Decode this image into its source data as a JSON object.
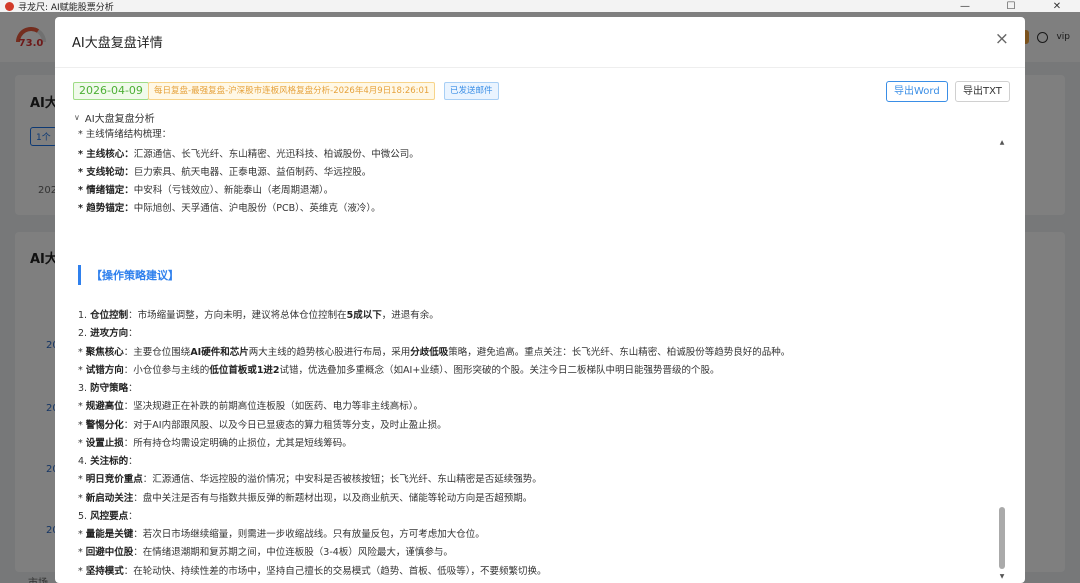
{
  "window": {
    "title": "寻龙尺: AI赋能股票分析",
    "minimize": "—",
    "maximize": "☐",
    "close": "✕"
  },
  "app": {
    "gauge_value": "73.0",
    "vip_label": "vip",
    "bg_title_1": "AI大",
    "bg_btn_1": "1个",
    "bg_date_prefix": "202",
    "bg_title_2": "AI大",
    "bg_row_labels": [
      "20",
      "20",
      "20",
      "20",
      "20"
    ],
    "bg_bottom": "市场"
  },
  "modal": {
    "title": "AI大盘复盘详情",
    "close_icon": "×",
    "date_tag": "2026-04-09",
    "report_tag": "每日复盘-最强复盘-沪深股市连板风格复盘分析-2026年4月9日18:26:01",
    "mail_tag": "已发送邮件",
    "export_word": "导出Word",
    "export_txt": "导出TXT",
    "section_title": "AI大盘复盘分析",
    "cut_line": "* 主线情绪结构梳理：",
    "top_lines": [
      {
        "bold": "* 主线核心：",
        "text": "汇源通信、长飞光纤、东山精密、光迅科技、柏诚股份、中微公司。"
      },
      {
        "bold": "* 支线轮动：",
        "text": "巨力索具、航天电器、正泰电源、益佰制药、华远控股。"
      },
      {
        "bold": "* 情绪锚定：",
        "text": "中安科（亏钱效应）、新能泰山（老周期退潮）。"
      },
      {
        "bold": "* 趋势锚定：",
        "text": "中际旭创、天孚通信、沪电股份（PCB）、英维克（液冷）。"
      }
    ],
    "strategy_title": "【操作策略建议】",
    "strategy_lines": [
      {
        "segments": [
          {
            "t": "1. "
          },
          {
            "t": "仓位控制",
            "b": true
          },
          {
            "t": "：市场缩量调整，方向未明，建议将总体仓位控制在"
          },
          {
            "t": "5成以下",
            "b": true
          },
          {
            "t": "，进退有余。"
          }
        ]
      },
      {
        "segments": [
          {
            "t": "2. "
          },
          {
            "t": "进攻方向",
            "b": true
          },
          {
            "t": "："
          }
        ]
      },
      {
        "segments": [
          {
            "t": "* "
          },
          {
            "t": "聚焦核心",
            "b": true
          },
          {
            "t": "：主要仓位围绕"
          },
          {
            "t": "AI硬件和芯片",
            "b": true
          },
          {
            "t": "两大主线的趋势核心股进行布局，采用"
          },
          {
            "t": "分歧低吸",
            "b": true
          },
          {
            "t": "策略，避免追高。重点关注：长飞光纤、东山精密、柏诚股份等趋势良好的品种。"
          }
        ]
      },
      {
        "segments": [
          {
            "t": "* "
          },
          {
            "t": "试错方向",
            "b": true
          },
          {
            "t": "：小仓位参与主线的"
          },
          {
            "t": "低位首板或1进2",
            "b": true
          },
          {
            "t": "试错，优选叠加多重概念（如AI+业绩）、图形突破的个股。关注今日二板梯队中明日能强势晋级的个股。"
          }
        ]
      },
      {
        "segments": [
          {
            "t": "3. "
          },
          {
            "t": "防守策略",
            "b": true
          },
          {
            "t": "："
          }
        ]
      },
      {
        "segments": [
          {
            "t": "* "
          },
          {
            "t": "规避高位",
            "b": true
          },
          {
            "t": "：坚决规避正在补跌的前期高位连板股（如医药、电力等非主线高标）。"
          }
        ]
      },
      {
        "segments": [
          {
            "t": "* "
          },
          {
            "t": "警惕分化",
            "b": true
          },
          {
            "t": "：对于AI内部跟风股、以及今日已显疲态的算力租赁等分支，及时止盈止损。"
          }
        ]
      },
      {
        "segments": [
          {
            "t": "* "
          },
          {
            "t": "设置止损",
            "b": true
          },
          {
            "t": "：所有持仓均需设定明确的止损位，尤其是短线筹码。"
          }
        ]
      },
      {
        "segments": [
          {
            "t": "4. "
          },
          {
            "t": "关注标的",
            "b": true
          },
          {
            "t": "："
          }
        ]
      },
      {
        "segments": [
          {
            "t": "* "
          },
          {
            "t": "明日竞价重点",
            "b": true
          },
          {
            "t": "：汇源通信、华远控股的溢价情况；中安科是否被核按钮；长飞光纤、东山精密是否延续强势。"
          }
        ]
      },
      {
        "segments": [
          {
            "t": "* "
          },
          {
            "t": "新启动关注",
            "b": true
          },
          {
            "t": "：盘中关注是否有与指数共振反弹的新题材出现，以及商业航天、储能等轮动方向是否超预期。"
          }
        ]
      },
      {
        "segments": [
          {
            "t": "5. "
          },
          {
            "t": "风控要点",
            "b": true
          },
          {
            "t": "："
          }
        ]
      },
      {
        "segments": [
          {
            "t": "* "
          },
          {
            "t": "量能是关键",
            "b": true
          },
          {
            "t": "：若次日市场继续缩量，则需进一步收缩战线。只有放量反包，方可考虑加大仓位。"
          }
        ]
      },
      {
        "segments": [
          {
            "t": "* "
          },
          {
            "t": "回避中位股",
            "b": true
          },
          {
            "t": "：在情绪退潮期和复苏期之间，中位连板股（3-4板）风险最大，谨慎参与。"
          }
        ]
      },
      {
        "segments": [
          {
            "t": "* "
          },
          {
            "t": "坚持模式",
            "b": true
          },
          {
            "t": "：在轮动快、持续性差的市场中，坚持自己擅长的交易模式（趋势、首板、低吸等），不要频繁切换。"
          }
        ]
      }
    ]
  }
}
